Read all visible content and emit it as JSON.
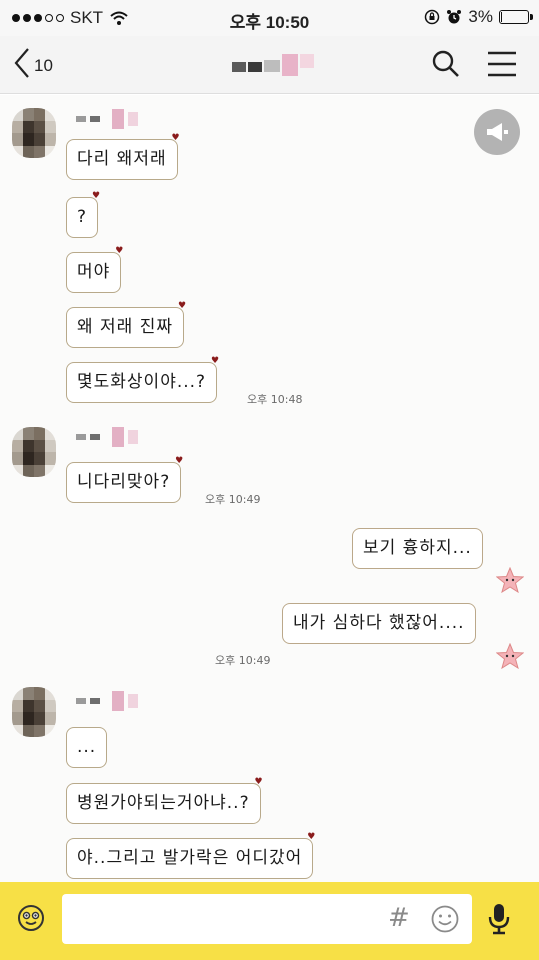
{
  "status_bar": {
    "carrier": "SKT",
    "time": "오후 10:50",
    "battery_percent": "3%",
    "battery_level": 0.03
  },
  "nav": {
    "back_count": "10",
    "title": "",
    "icons": [
      "back-chevron-icon",
      "search-icon",
      "menu-icon"
    ]
  },
  "messages": [
    {
      "from": "them",
      "text": "다리 왜저래"
    },
    {
      "from": "them",
      "text": "?"
    },
    {
      "from": "them",
      "text": "머야"
    },
    {
      "from": "them",
      "text": "왜 저래 진짜"
    },
    {
      "from": "them",
      "text": "몇도화상이야...?",
      "time": "오후 10:48"
    },
    {
      "from": "them",
      "text": "니다리맞아?",
      "time": "오후 10:49"
    },
    {
      "from": "me",
      "text": "보기 흉하지..."
    },
    {
      "from": "me",
      "text": "내가 심하다 했잖어....",
      "time": "오후 10:49"
    },
    {
      "from": "them",
      "text": "..."
    },
    {
      "from": "them",
      "text": "병원가야되는거아냐..?"
    },
    {
      "from": "them",
      "text": "야..그리고 발가락은 어디갔어"
    }
  ],
  "input": {
    "value": "",
    "hash_label": "#",
    "icons": [
      "emoticon-icon",
      "hashtag-icon",
      "smile-icon",
      "microphone-icon"
    ]
  },
  "colors": {
    "input_bar": "#f7e046",
    "bubble_border": "#b8a98a",
    "chat_background": "#fbfbfa"
  }
}
